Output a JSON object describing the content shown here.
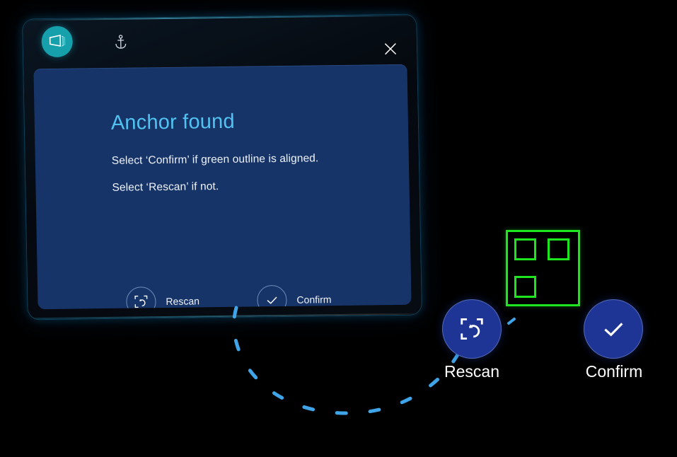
{
  "app": {
    "icon_name": "hologram-window-icon",
    "accent_teal": "#15a0ab",
    "panel_blue": "#173469",
    "heading_blue": "#52c3f0",
    "marker_green": "#1ee61e",
    "button_blue": "#1e3596"
  },
  "titlebar": {
    "app_icon_label": "hologram-window-icon",
    "anchor_icon_label": "anchor-icon",
    "close_label": "Close"
  },
  "dialog": {
    "heading": "Anchor found",
    "line_1": "Select ‘Confirm’ if green outline is aligned.",
    "line_2": "Select ‘Rescan’ if not.",
    "actions": [
      {
        "label": "Rescan",
        "icon": "rescan-frame-refresh-icon"
      },
      {
        "label": "Confirm",
        "icon": "check-icon"
      }
    ]
  },
  "floating_buttons": [
    {
      "label": "Rescan",
      "icon": "rescan-frame-refresh-icon"
    },
    {
      "label": "Confirm",
      "icon": "check-icon"
    }
  ],
  "marker": {
    "name": "anchor-qr-marker",
    "cells": [
      "top-left",
      "top-right",
      "bottom-left"
    ]
  }
}
